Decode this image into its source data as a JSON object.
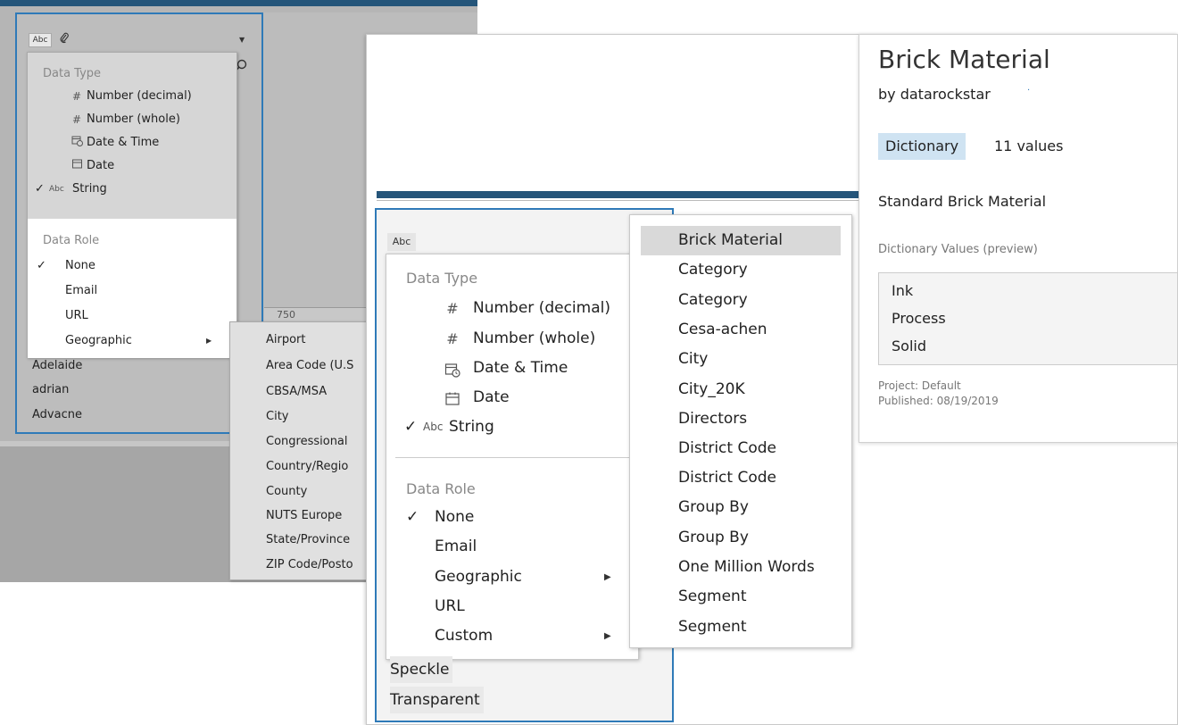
{
  "background_view": {
    "column_header": {
      "type_badge": "Abc",
      "clip_icon": "paperclip-icon"
    },
    "type_menu": {
      "data_type_label": "Data Type",
      "types": [
        {
          "icon": "#",
          "label": "Number (decimal)",
          "icon_name": "hash-icon"
        },
        {
          "icon": "#",
          "label": "Number (whole)",
          "icon_name": "hash-icon"
        },
        {
          "icon": "📅",
          "label": "Date & Time",
          "icon_name": "calendar-clock-icon"
        },
        {
          "icon": "📅",
          "label": "Date",
          "icon_name": "calendar-icon"
        },
        {
          "icon": "Abc",
          "label": "String",
          "checked": true
        }
      ],
      "data_role_label": "Data Role",
      "roles": [
        {
          "label": "None",
          "checked": true
        },
        {
          "label": "Email"
        },
        {
          "label": "URL"
        },
        {
          "label": "Geographic",
          "has_submenu": true
        }
      ]
    },
    "geographic_submenu": [
      "Airport",
      "Area Code (U.S",
      "CBSA/MSA",
      "City",
      "Congressional",
      "Country/Regio",
      "County",
      "NUTS Europe",
      "State/Province",
      "ZIP Code/Posto"
    ],
    "column_values": [
      "Adelaide",
      "adrian",
      "Advacne"
    ],
    "strip_label": "750"
  },
  "main_view": {
    "type_badge": "Abc",
    "type_menu": {
      "data_type_label": "Data Type",
      "types": [
        {
          "icon": "#",
          "label": "Number (decimal)"
        },
        {
          "icon": "#",
          "label": "Number (whole)"
        },
        {
          "icon": "📅",
          "label": "Date & Time"
        },
        {
          "icon": "📅",
          "label": "Date"
        },
        {
          "icon": "Abc",
          "label": "String",
          "checked": true
        }
      ],
      "data_role_label": "Data Role",
      "roles": [
        {
          "label": "None",
          "checked": true
        },
        {
          "label": "Email"
        },
        {
          "label": "Geographic",
          "has_submenu": true
        },
        {
          "label": "URL"
        },
        {
          "label": "Custom",
          "has_submenu": true
        }
      ]
    },
    "custom_roles": [
      "Brick Material",
      "Category",
      "Category",
      "Cesa-achen",
      "City",
      "City_20K",
      "Directors",
      "District Code",
      "District Code",
      "Group By",
      "Group By",
      "One Million Words",
      "Segment",
      "Segment"
    ],
    "selected_custom_role": "Brick Material",
    "column_values": [
      "Speckle",
      "Transparent"
    ]
  },
  "details": {
    "title": "Brick Material",
    "by_prefix": "by",
    "author": "datarockstar",
    "badge": "Dictionary",
    "count": "11 values",
    "description": "Standard Brick Material",
    "preview_label": "Dictionary Values (preview)",
    "preview_values": [
      "Ink",
      "Process",
      "Solid"
    ],
    "project": "Project: Default",
    "published": "Published: 08/19/2019"
  },
  "colors": {
    "accent": "#2f7ab8",
    "topbar": "#24557a",
    "badge_bg": "#cfe3f2",
    "selected_bg": "#d9d9d9"
  }
}
